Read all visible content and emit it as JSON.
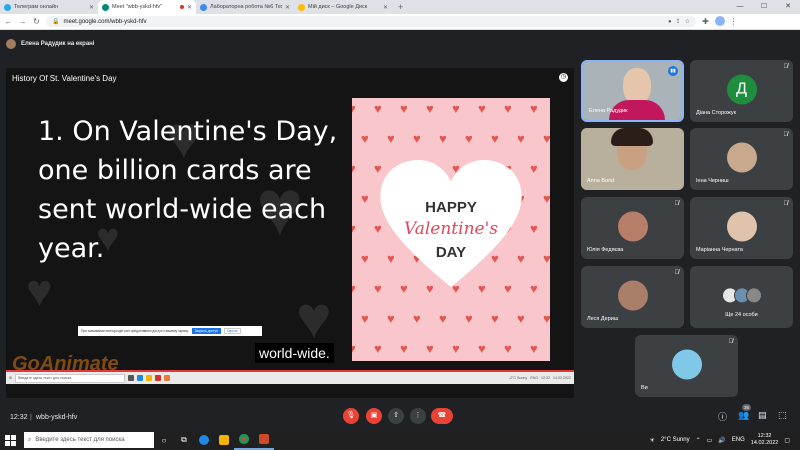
{
  "browser": {
    "tabs": [
      {
        "title": "Телеграм онлайн",
        "color": "#29a9eb",
        "active": false
      },
      {
        "title": "Meet \"wbb-yskd-hfv\"",
        "color": "#00897b",
        "active": true
      },
      {
        "title": "Лабораторна робота №6 Техн",
        "color": "#4285f4",
        "active": false
      },
      {
        "title": "Мій диск – Google Диск",
        "color": "#fbbc04",
        "active": false
      }
    ],
    "url": "meet.google.com/wbb-yskd-hfv"
  },
  "presenting": {
    "label": "Елена Радудик на екрані"
  },
  "stage": {
    "title": "History Of St. Valentine's Day",
    "slide_text": "1. On Valentine's Day, one billion cards are sent world-wide each year.",
    "card": {
      "line1": "HAPPY",
      "line2": "Valentine's",
      "line3": "DAY"
    },
    "caption": "world-wide.",
    "notice": {
      "text": "При скачивании meet.google.com предоставлен доступ к вашему экрану.",
      "btn_primary": "Закрыть доступ",
      "btn_secondary": "Скрыть"
    },
    "watermark": "GoAnimate",
    "inner_taskbar": {
      "search": "Введите здесь текст для поиска",
      "weather": "-2°C  Sunny",
      "lang": "ENG",
      "time": "12:32",
      "date": "14.02.2022"
    }
  },
  "participants": [
    {
      "name": "Елена Радудик",
      "type": "video",
      "self": true,
      "speaking": true
    },
    {
      "name": "Діана Сторожук",
      "type": "letter",
      "letter": "Д",
      "color": "#1e8e3e"
    },
    {
      "name": "Anna Bond",
      "type": "video"
    },
    {
      "name": "Інна Черниш",
      "type": "avatar",
      "color": "#c9a98e"
    },
    {
      "name": "Юлія Федяєва",
      "type": "avatar",
      "color": "#b77e6a"
    },
    {
      "name": "Маріанна Черната",
      "type": "avatar",
      "color": "#e0c3ad"
    },
    {
      "name": "Леся Дериш",
      "type": "avatar",
      "color": "#a97f6a"
    },
    {
      "name": "Ще 24 особи",
      "type": "group"
    },
    {
      "name": "Ви",
      "type": "avatar",
      "color": "#7fc8e8"
    }
  ],
  "controls": {
    "time": "12:32",
    "separator": "|",
    "meeting_code": "wbb-yskd-hfv",
    "people_count": "35"
  },
  "taskbar": {
    "search": "Введите здесь текст для поиска",
    "weather": "2°C  Sunny",
    "lang": "ENG",
    "time": "12:32",
    "date": "14.02.2022"
  }
}
